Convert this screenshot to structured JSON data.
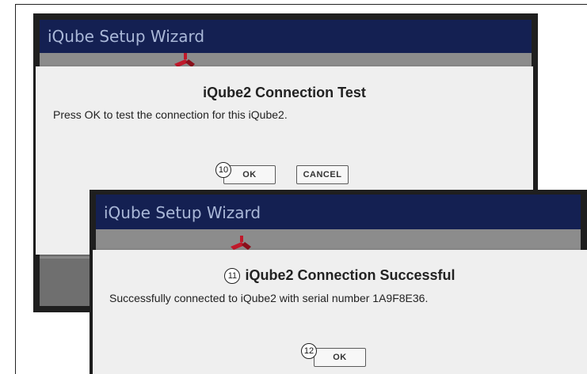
{
  "back_window": {
    "title": "iQube Setup Wizard",
    "dialog": {
      "title": "iQube2 Connection Test",
      "message": "Press OK to test the connection for this iQube2.",
      "ok_label": "OK",
      "cancel_label": "CANCEL"
    }
  },
  "front_window": {
    "title": "iQube Setup Wizard",
    "dialog": {
      "title": "iQube2 Connection Successful",
      "message": "Successfully connected to iQube2 with serial number 1A9F8E36.",
      "ok_label": "OK"
    }
  },
  "callouts": {
    "c10": "10",
    "c11": "11",
    "c12": "12"
  },
  "colors": {
    "titlebar": "#142052",
    "dialog_bg": "#efefef",
    "frame_bg": "#1f1f1f",
    "logo_accent": "#c0192b"
  }
}
